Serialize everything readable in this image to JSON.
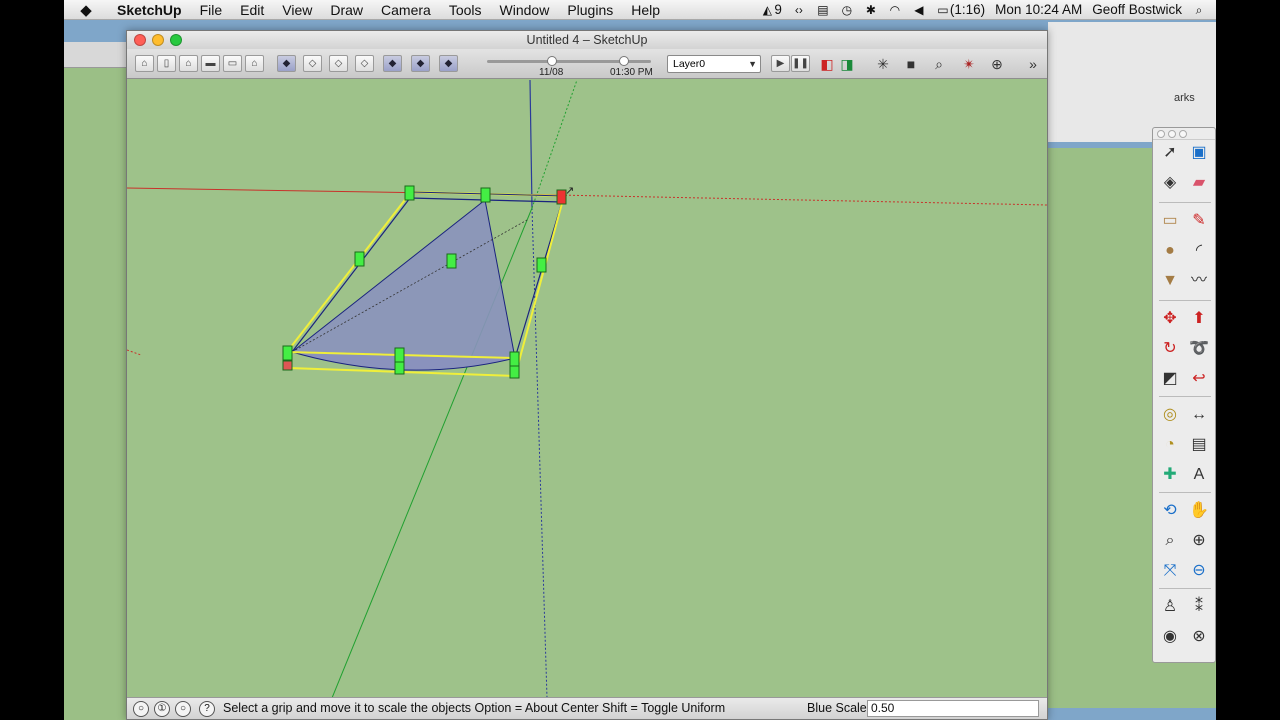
{
  "menubar": {
    "app": "SketchUp",
    "items": [
      "File",
      "Edit",
      "View",
      "Draw",
      "Camera",
      "Tools",
      "Window",
      "Plugins",
      "Help"
    ],
    "status": {
      "adobe": "9",
      "battery": "(1:16)",
      "clock": "Mon 10:24 AM",
      "user": "Geoff Bostwick"
    }
  },
  "bg_window_label": "arks",
  "window": {
    "title": "Untitled 4 – SketchUp",
    "toolbar": {
      "shadow_date": "11/08",
      "shadow_time": "01:30 PM",
      "layer": "Layer0"
    }
  },
  "statusbar": {
    "message": "Select a grip and move it to scale the objects  Option = About Center  Shift = Toggle Uniform",
    "vcb_label": "Blue Scale",
    "vcb_value": "0.50"
  },
  "colors": {
    "viewport_bg": "#9ec28a",
    "face": "#8a92bd",
    "grip": "#44ee44",
    "bbox": "#f0ef3a",
    "edge": "#1a237e"
  },
  "palette_tools": [
    "select-icon",
    "component-icon",
    "paint-bucket-icon",
    "eraser-icon",
    "rectangle-icon",
    "line-icon",
    "circle-icon",
    "arc-icon",
    "polygon-icon",
    "freehand-icon",
    "move-icon",
    "push-pull-icon",
    "rotate-icon",
    "follow-me-icon",
    "scale-icon",
    "offset-icon",
    "tape-measure-icon",
    "dimension-icon",
    "protractor-icon",
    "text-icon",
    "axes-icon",
    "3d-text-icon",
    "orbit-icon",
    "pan-icon",
    "zoom-icon",
    "zoom-window-icon",
    "zoom-extents-icon",
    "previous-view-icon",
    "position-camera-icon",
    "walk-icon",
    "look-around-icon",
    "section-plane-icon"
  ]
}
